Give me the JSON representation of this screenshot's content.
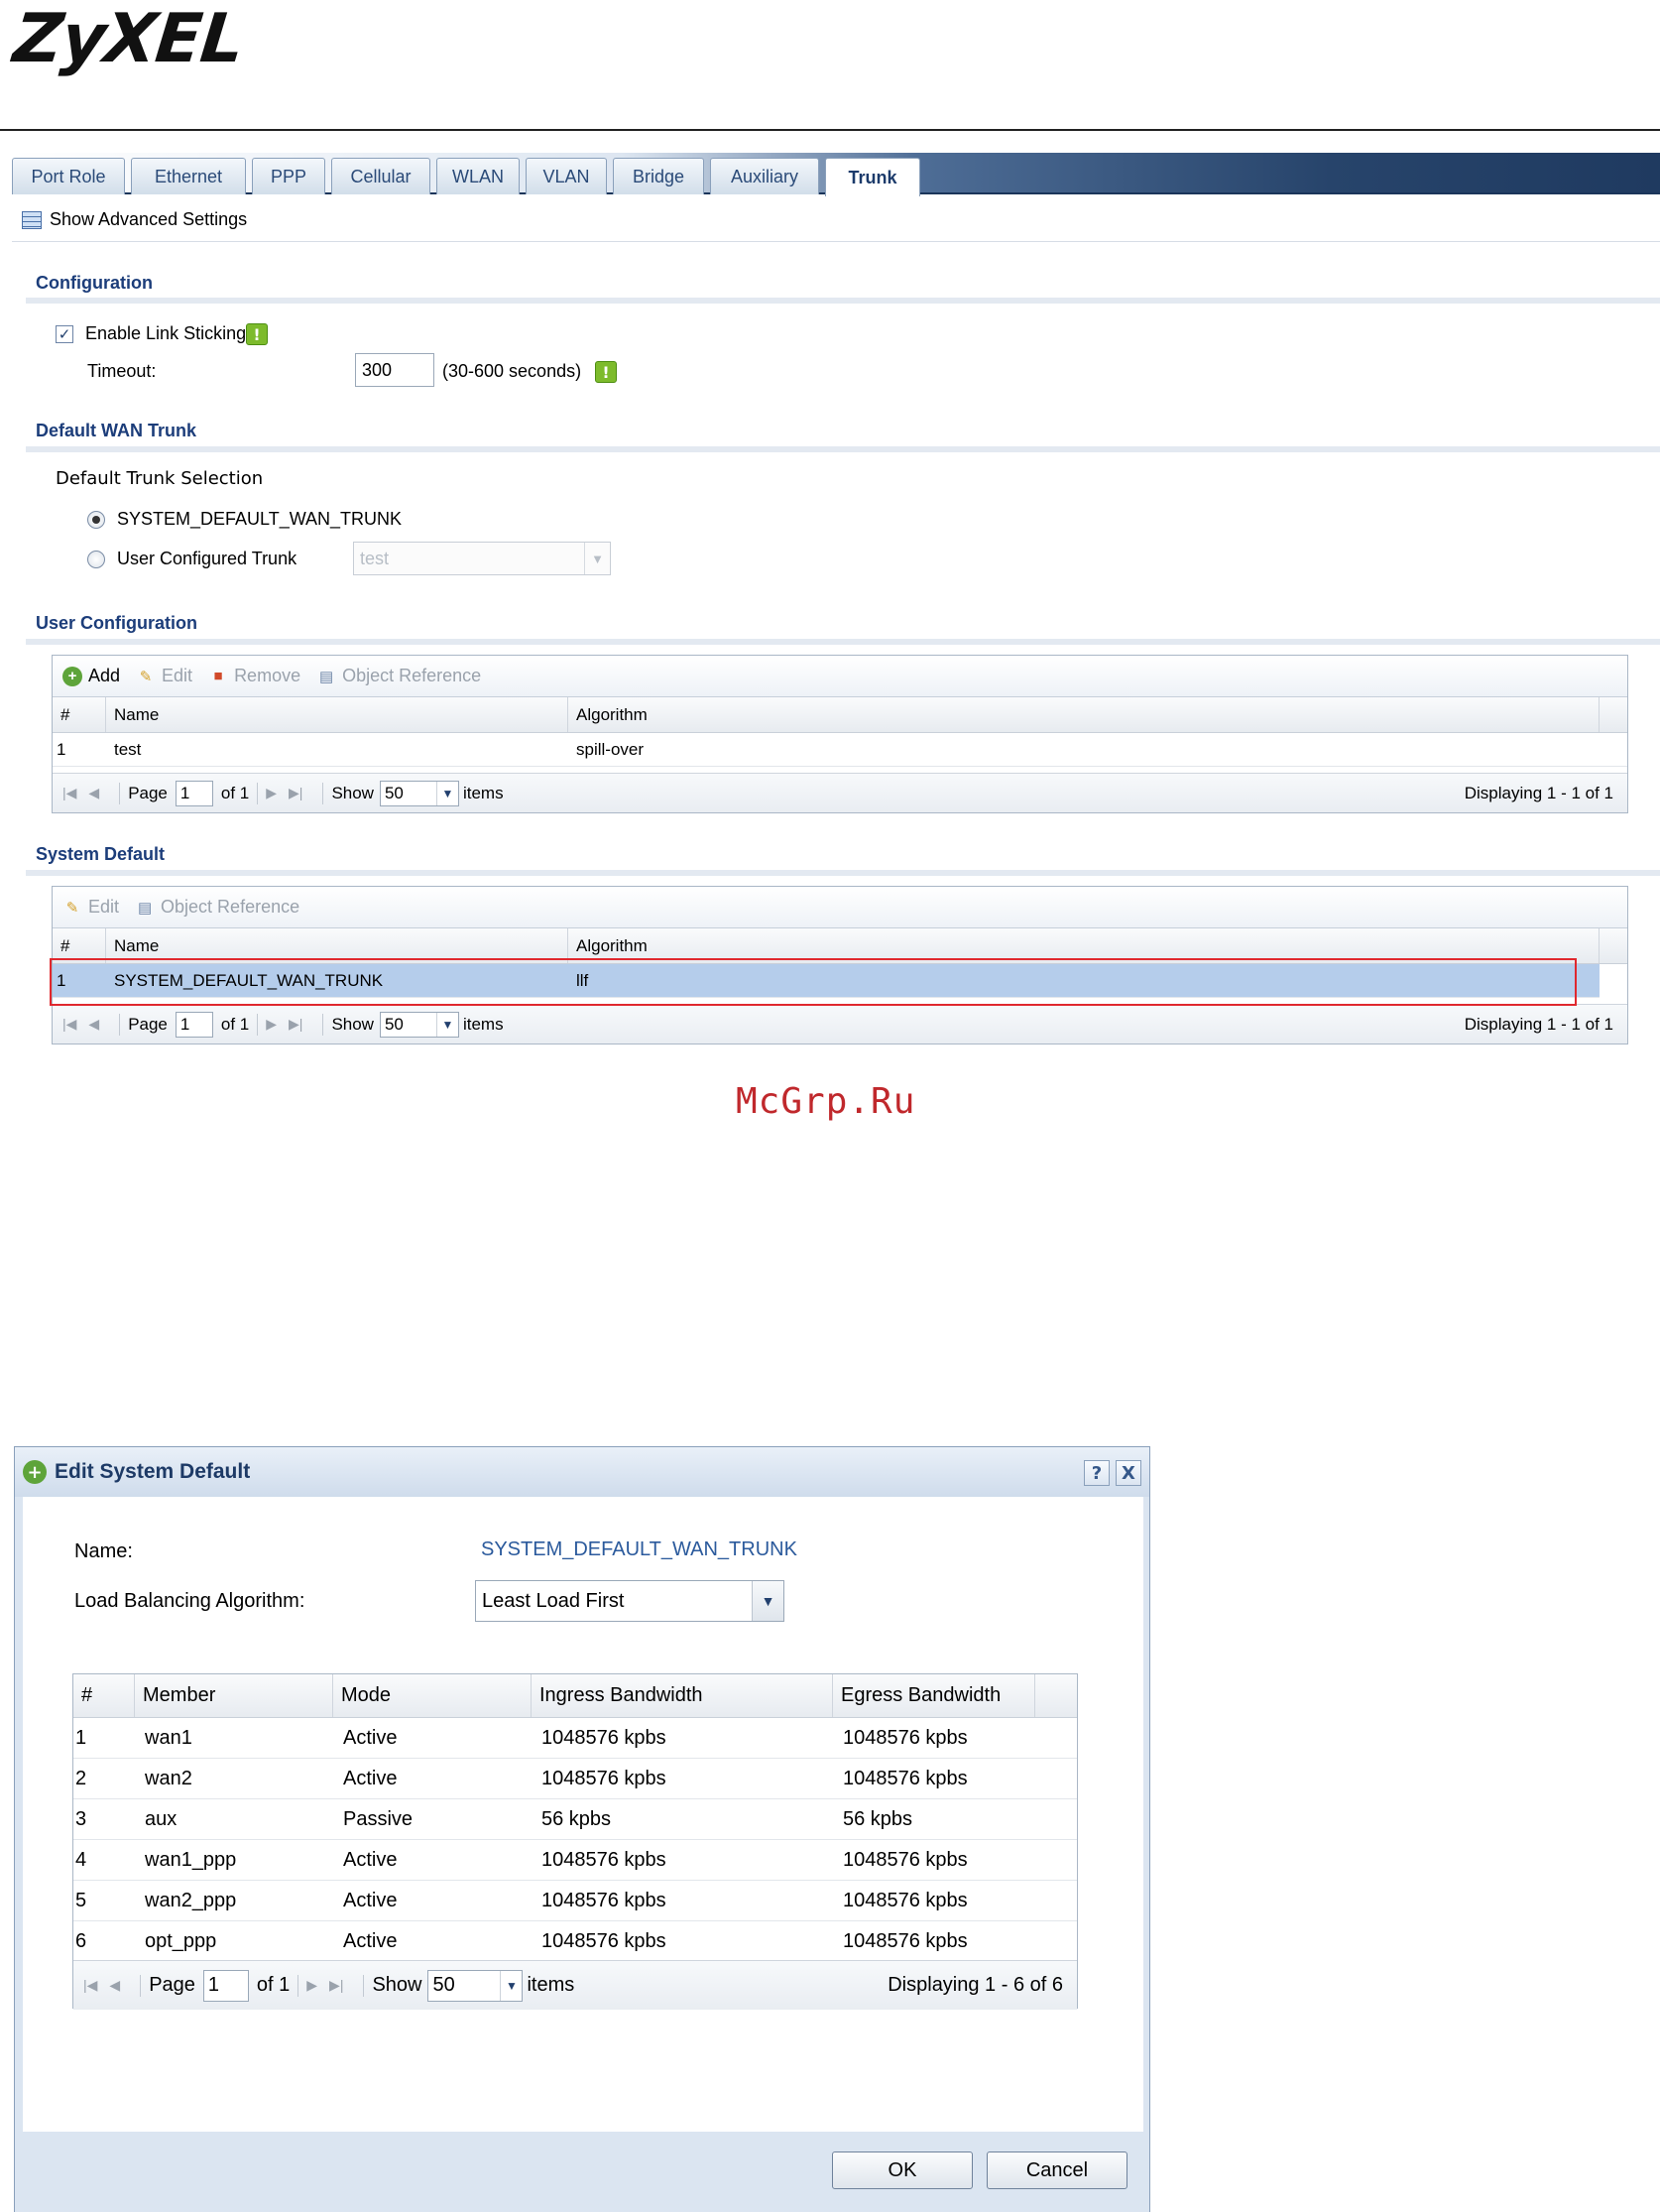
{
  "logo": "ZyXEL",
  "tabs": [
    "Port Role",
    "Ethernet",
    "PPP",
    "Cellular",
    "WLAN",
    "VLAN",
    "Bridge",
    "Auxiliary",
    "Trunk"
  ],
  "active_tab": "Trunk",
  "advanced_settings": "Show Advanced Settings",
  "configuration": {
    "title": "Configuration",
    "enable_link_sticking": "Enable Link Sticking",
    "enable_link_sticking_checked": true,
    "timeout_label": "Timeout:",
    "timeout_value": "300",
    "timeout_hint": "(30-600 seconds)"
  },
  "default_wan_trunk": {
    "title": "Default WAN Trunk",
    "selection_label": "Default Trunk Selection",
    "option_system": "SYSTEM_DEFAULT_WAN_TRUNK",
    "option_user": "User Configured Trunk",
    "selected": "system",
    "user_trunk_value": "test"
  },
  "user_configuration": {
    "title": "User Configuration",
    "toolbar": {
      "add": "Add",
      "edit": "Edit",
      "remove": "Remove",
      "object_reference": "Object Reference"
    },
    "columns": [
      "#",
      "Name",
      "Algorithm"
    ],
    "rows": [
      {
        "num": "1",
        "name": "test",
        "algorithm": "spill-over"
      }
    ],
    "pager": {
      "page_label": "Page",
      "page": "1",
      "of": "of 1",
      "show": "Show",
      "per_page": "50",
      "items": "items",
      "displaying": "Displaying 1 - 1 of 1"
    }
  },
  "system_default": {
    "title": "System Default",
    "toolbar": {
      "edit": "Edit",
      "object_reference": "Object Reference"
    },
    "columns": [
      "#",
      "Name",
      "Algorithm"
    ],
    "rows": [
      {
        "num": "1",
        "name": "SYSTEM_DEFAULT_WAN_TRUNK",
        "algorithm": "llf"
      }
    ],
    "pager": {
      "page_label": "Page",
      "page": "1",
      "of": "of 1",
      "show": "Show",
      "per_page": "50",
      "items": "items",
      "displaying": "Displaying 1 - 1 of 1"
    }
  },
  "watermark": "McGrp.Ru",
  "dialog": {
    "title": "Edit System Default",
    "help": "?",
    "close": "X",
    "name_label": "Name:",
    "name_value": "SYSTEM_DEFAULT_WAN_TRUNK",
    "algorithm_label": "Load Balancing Algorithm:",
    "algorithm_value": "Least Load First",
    "columns": [
      "#",
      "Member",
      "Mode",
      "Ingress Bandwidth",
      "Egress Bandwidth"
    ],
    "rows": [
      {
        "num": "1",
        "member": "wan1",
        "mode": "Active",
        "ingress": "1048576 kpbs",
        "egress": "1048576 kpbs"
      },
      {
        "num": "2",
        "member": "wan2",
        "mode": "Active",
        "ingress": "1048576 kpbs",
        "egress": "1048576 kpbs"
      },
      {
        "num": "3",
        "member": "aux",
        "mode": "Passive",
        "ingress": "56 kpbs",
        "egress": "56 kpbs"
      },
      {
        "num": "4",
        "member": "wan1_ppp",
        "mode": "Active",
        "ingress": "1048576 kpbs",
        "egress": "1048576 kpbs"
      },
      {
        "num": "5",
        "member": "wan2_ppp",
        "mode": "Active",
        "ingress": "1048576 kpbs",
        "egress": "1048576 kpbs"
      },
      {
        "num": "6",
        "member": "opt_ppp",
        "mode": "Active",
        "ingress": "1048576 kpbs",
        "egress": "1048576 kpbs"
      }
    ],
    "pager": {
      "page_label": "Page",
      "page": "1",
      "of": "of 1",
      "show": "Show",
      "per_page": "50",
      "items": "items",
      "displaying": "Displaying 1 - 6 of 6"
    },
    "ok": "OK",
    "cancel": "Cancel"
  }
}
